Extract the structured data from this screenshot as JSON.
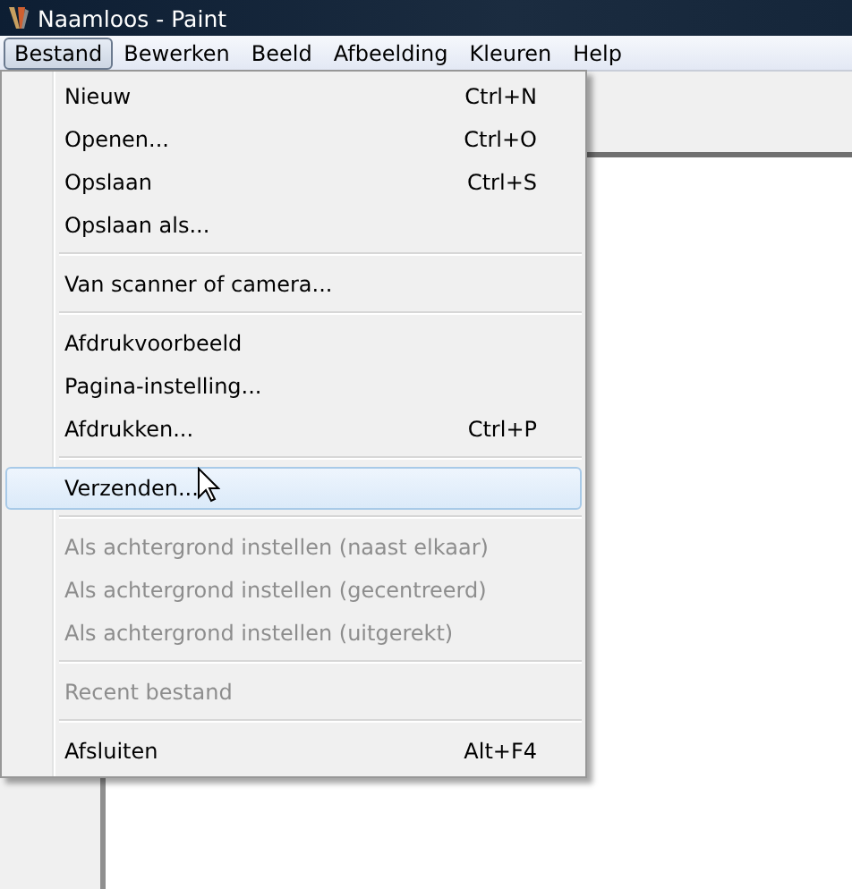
{
  "window": {
    "title": "Naamloos - Paint"
  },
  "menu_bar": [
    {
      "label": "Bestand",
      "selected": true
    },
    {
      "label": "Bewerken",
      "selected": false
    },
    {
      "label": "Beeld",
      "selected": false
    },
    {
      "label": "Afbeelding",
      "selected": false
    },
    {
      "label": "Kleuren",
      "selected": false
    },
    {
      "label": "Help",
      "selected": false
    }
  ],
  "menu": [
    {
      "kind": "item",
      "label": "Nieuw",
      "shortcut": "Ctrl+N",
      "disabled": false,
      "selected": false
    },
    {
      "kind": "item",
      "label": "Openen...",
      "shortcut": "Ctrl+O",
      "disabled": false,
      "selected": false
    },
    {
      "kind": "item",
      "label": "Opslaan",
      "shortcut": "Ctrl+S",
      "disabled": false,
      "selected": false
    },
    {
      "kind": "item",
      "label": "Opslaan als...",
      "disabled": false,
      "selected": false
    },
    {
      "kind": "separator"
    },
    {
      "kind": "item",
      "label": "Van scanner of camera...",
      "disabled": false,
      "selected": false
    },
    {
      "kind": "separator"
    },
    {
      "kind": "item",
      "label": "Afdrukvoorbeeld",
      "disabled": false,
      "selected": false
    },
    {
      "kind": "item",
      "label": "Pagina-instelling...",
      "disabled": false,
      "selected": false
    },
    {
      "kind": "item",
      "label": "Afdrukken...",
      "shortcut": "Ctrl+P",
      "disabled": false,
      "selected": false
    },
    {
      "kind": "separator"
    },
    {
      "kind": "item",
      "label": "Verzenden...",
      "disabled": false,
      "selected": true
    },
    {
      "kind": "separator"
    },
    {
      "kind": "item",
      "label": "Als achtergrond instellen (naast elkaar)",
      "disabled": true,
      "selected": false
    },
    {
      "kind": "item",
      "label": "Als achtergrond instellen (gecentreerd)",
      "disabled": true,
      "selected": false
    },
    {
      "kind": "item",
      "label": "Als achtergrond instellen (uitgerekt)",
      "disabled": true,
      "selected": false
    },
    {
      "kind": "separator"
    },
    {
      "kind": "item",
      "label": "Recent bestand",
      "disabled": true,
      "selected": false
    },
    {
      "kind": "separator"
    },
    {
      "kind": "item",
      "label": "Afsluiten",
      "shortcut": "Alt+F4",
      "disabled": false,
      "selected": false
    }
  ]
}
